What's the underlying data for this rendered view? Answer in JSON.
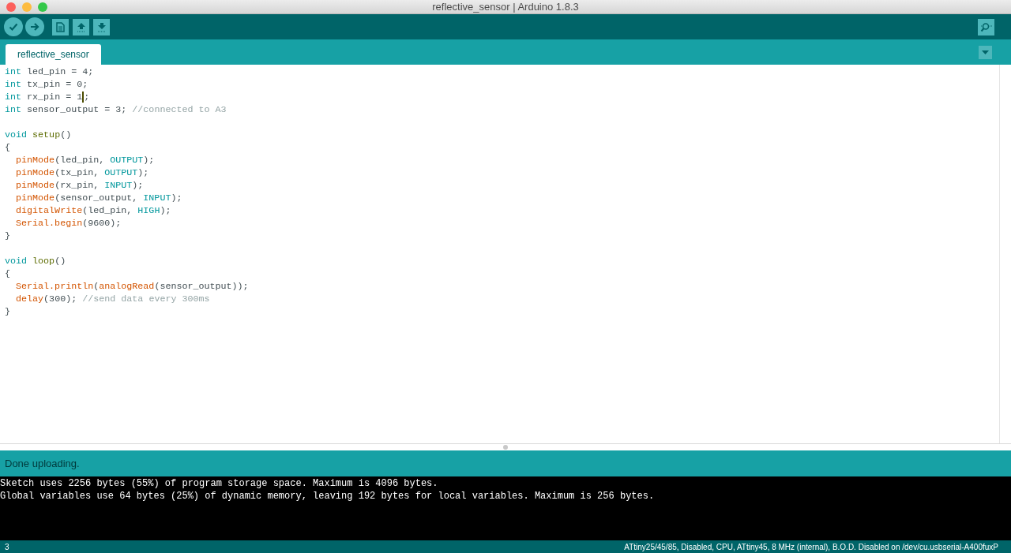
{
  "window": {
    "title": "reflective_sensor | Arduino 1.8.3"
  },
  "toolbar": {
    "buttons": [
      {
        "kind": "verify"
      },
      {
        "kind": "upload"
      },
      {
        "kind": "new"
      },
      {
        "kind": "open"
      },
      {
        "kind": "save"
      }
    ],
    "right": {
      "kind": "monitor"
    }
  },
  "tabs": [
    {
      "label": "reflective_sensor",
      "selected": true
    }
  ],
  "editor": {
    "blocks": [
      [
        [
          {
            "kind": "type",
            "text": "int"
          },
          {
            "kind": "plain",
            "text": " led_pin = 4;"
          }
        ],
        [
          {
            "kind": "type",
            "text": "int"
          },
          {
            "kind": "plain",
            "text": " tx_pin = 0;"
          }
        ],
        [
          {
            "kind": "type",
            "text": "int"
          },
          {
            "kind": "plain",
            "text": " rx_pin = 1"
          },
          {
            "kind": "caret"
          },
          {
            "kind": "plain",
            "text": ";"
          }
        ],
        [
          {
            "kind": "type",
            "text": "int"
          },
          {
            "kind": "plain",
            "text": " sensor_output = 3; "
          },
          {
            "kind": "comment",
            "text": "//connected to A3"
          }
        ]
      ],
      [
        [
          {
            "kind": "type",
            "text": "void "
          },
          {
            "kind": "func",
            "text": "setup"
          },
          {
            "kind": "plain",
            "text": "()"
          }
        ],
        [
          {
            "kind": "plain",
            "text": "{"
          }
        ],
        [
          {
            "kind": "builtin",
            "text": "  pinMode"
          },
          {
            "kind": "plain",
            "text": "(led_pin, "
          },
          {
            "kind": "const",
            "text": "OUTPUT"
          },
          {
            "kind": "plain",
            "text": ");"
          }
        ],
        [
          {
            "kind": "builtin",
            "text": "  pinMode"
          },
          {
            "kind": "plain",
            "text": "(tx_pin, "
          },
          {
            "kind": "const",
            "text": "OUTPUT"
          },
          {
            "kind": "plain",
            "text": ");"
          }
        ],
        [
          {
            "kind": "builtin",
            "text": "  pinMode"
          },
          {
            "kind": "plain",
            "text": "(rx_pin, "
          },
          {
            "kind": "const",
            "text": "INPUT"
          },
          {
            "kind": "plain",
            "text": ");"
          }
        ],
        [
          {
            "kind": "builtin",
            "text": "  pinMode"
          },
          {
            "kind": "plain",
            "text": "(sensor_output, "
          },
          {
            "kind": "const",
            "text": "INPUT"
          },
          {
            "kind": "plain",
            "text": ");"
          }
        ],
        [
          {
            "kind": "builtin",
            "text": "  digitalWrite"
          },
          {
            "kind": "plain",
            "text": "(led_pin, "
          },
          {
            "kind": "const",
            "text": "HIGH"
          },
          {
            "kind": "plain",
            "text": ");"
          }
        ],
        [
          {
            "kind": "builtin",
            "text": "  Serial.begin"
          },
          {
            "kind": "plain",
            "text": "(9600);"
          }
        ],
        [
          {
            "kind": "plain",
            "text": "}"
          }
        ]
      ],
      [
        [
          {
            "kind": "type",
            "text": "void "
          },
          {
            "kind": "func",
            "text": "loop"
          },
          {
            "kind": "plain",
            "text": "()"
          }
        ],
        [
          {
            "kind": "plain",
            "text": "{"
          }
        ],
        [
          {
            "kind": "builtin",
            "text": "  Serial.println"
          },
          {
            "kind": "plain",
            "text": "("
          },
          {
            "kind": "builtin",
            "text": "analogRead"
          },
          {
            "kind": "plain",
            "text": "(sensor_output));"
          }
        ],
        [
          {
            "kind": "builtin",
            "text": "  delay"
          },
          {
            "kind": "plain",
            "text": "(300); "
          },
          {
            "kind": "comment",
            "text": "//send data every 300ms"
          }
        ],
        [
          {
            "kind": "plain",
            "text": "}"
          }
        ]
      ]
    ]
  },
  "status": {
    "message": "Done uploading."
  },
  "console": {
    "lines": [
      "Sketch uses 2256 bytes (55%) of program storage space. Maximum is 4096 bytes.",
      "Global variables use 64 bytes (25%) of dynamic memory, leaving 192 bytes for local variables. Maximum is 256 bytes."
    ]
  },
  "footer": {
    "line_number": "3",
    "board": "ATtiny25/45/85, Disabled, CPU, ATtiny45, 8 MHz (internal), B.O.D. Disabled on /dev/cu.usbserial-A400fuxP"
  }
}
